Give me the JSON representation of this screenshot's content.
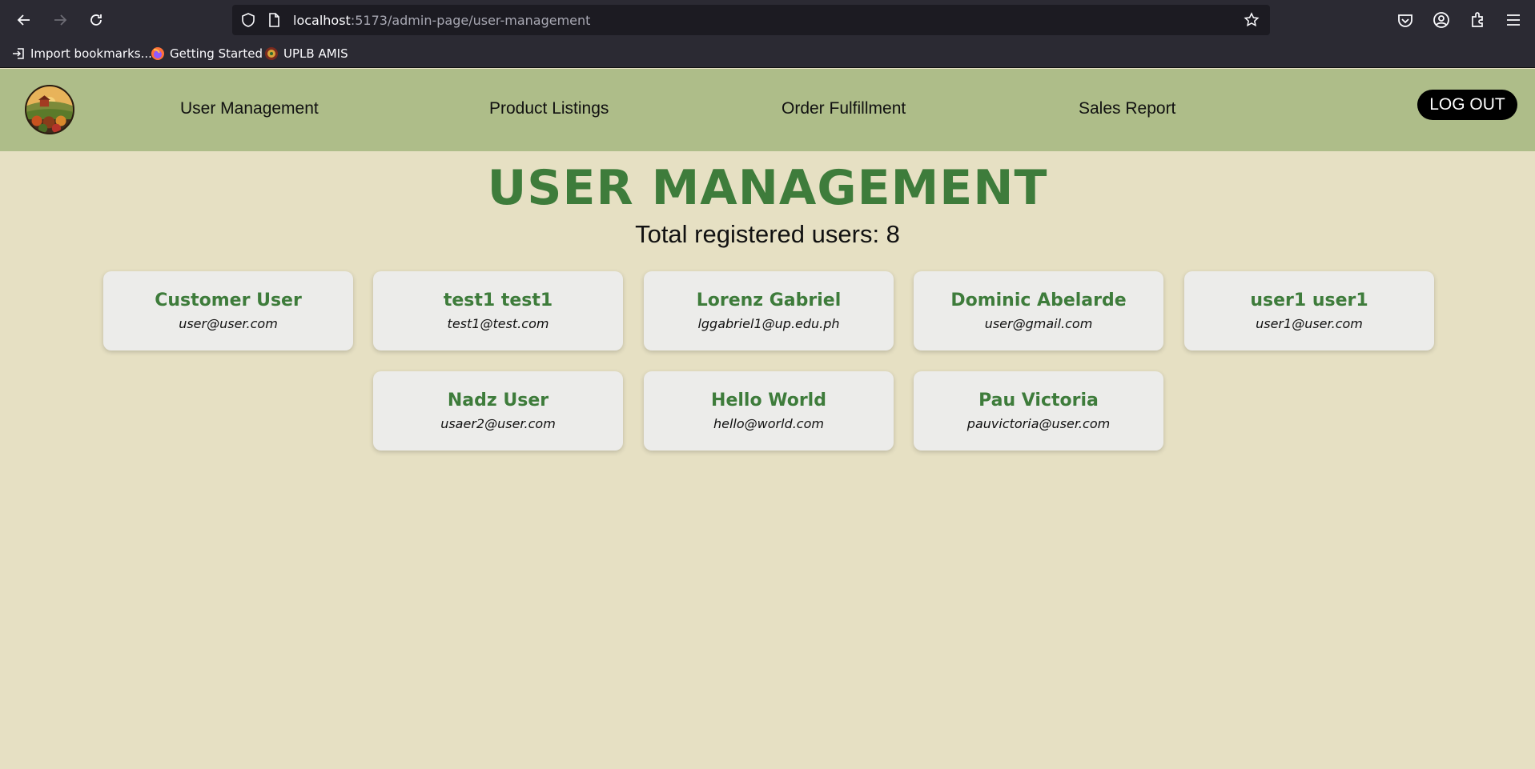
{
  "browser": {
    "url_host": "localhost",
    "url_path": ":5173/admin-page/user-management",
    "bookmarks": [
      {
        "label": "Import bookmarks...",
        "icon": "import-icon"
      },
      {
        "label": "Getting Started",
        "icon": "firefox-icon"
      },
      {
        "label": "UPLB AMIS",
        "icon": "uplb-icon"
      }
    ]
  },
  "nav": {
    "links": [
      "User Management",
      "Product Listings",
      "Order Fulfillment",
      "Sales Report"
    ],
    "logout_label": "LOG OUT"
  },
  "main": {
    "title": "USER MANAGEMENT",
    "subtitle": "Total registered users: 8",
    "users": [
      {
        "name": "Customer User",
        "email": "user@user.com"
      },
      {
        "name": "test1 test1",
        "email": "test1@test.com"
      },
      {
        "name": "Lorenz Gabriel",
        "email": "lggabriel1@up.edu.ph"
      },
      {
        "name": "Dominic Abelarde",
        "email": "user@gmail.com"
      },
      {
        "name": "user1 user1",
        "email": "user1@user.com"
      },
      {
        "name": "Nadz User",
        "email": "usaer2@user.com"
      },
      {
        "name": "Hello World",
        "email": "hello@world.com"
      },
      {
        "name": "Pau Victoria",
        "email": "pauvictoria@user.com"
      }
    ]
  },
  "colors": {
    "accent_green": "#3e7c3b",
    "navbar_bg": "#aebd89",
    "page_bg": "#e6e0c3",
    "card_bg": "#ececea"
  }
}
